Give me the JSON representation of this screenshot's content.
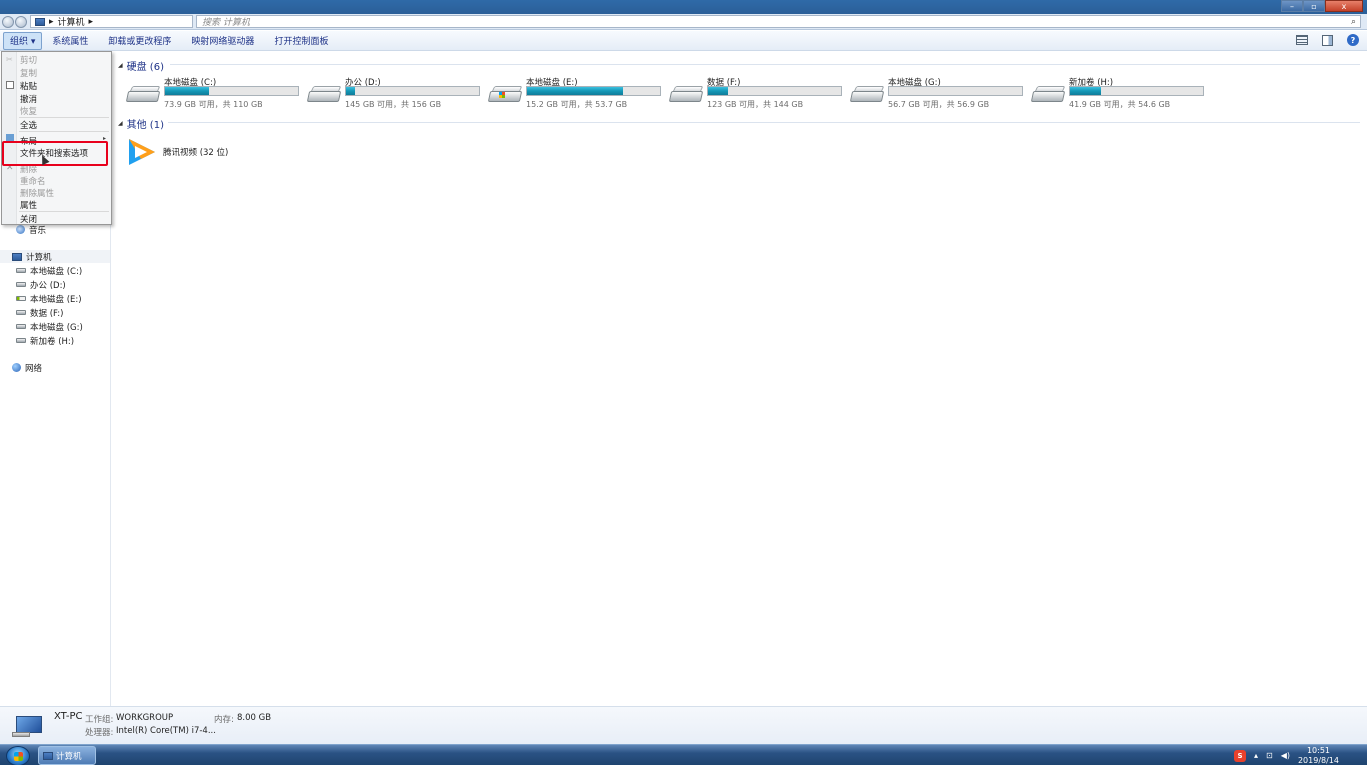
{
  "address": {
    "crumb_label": "计算机",
    "arrow": "▸"
  },
  "search": {
    "placeholder": "搜索 计算机"
  },
  "toolbar": {
    "organize_label": "组织 ▾",
    "items": [
      "系统属性",
      "卸载或更改程序",
      "映射网络驱动器",
      "打开控制面板"
    ]
  },
  "menu": {
    "items": [
      {
        "label": "剪切",
        "disabled": true
      },
      {
        "label": "复制",
        "disabled": true
      },
      {
        "label": "粘贴",
        "disabled": false
      },
      {
        "label": "撤消",
        "disabled": false
      },
      {
        "label": "恢复",
        "disabled": true
      },
      {
        "label": "全选",
        "disabled": false
      },
      {
        "label": "布局",
        "disabled": false
      },
      {
        "label": "文件夹和搜索选项",
        "disabled": false
      },
      {
        "label": "删除",
        "disabled": true
      },
      {
        "label": "重命名",
        "disabled": true
      },
      {
        "label": "删除属性",
        "disabled": true
      },
      {
        "label": "属性",
        "disabled": false
      },
      {
        "label": "关闭",
        "disabled": false
      }
    ]
  },
  "nav": {
    "music": "音乐",
    "computer": "计算机",
    "drives": [
      "本地磁盘 (C:)",
      "办公 (D:)",
      "本地磁盘 (E:)",
      "数据 (F:)",
      "本地磁盘 (G:)",
      "新加卷 (H:)"
    ],
    "network": "网络"
  },
  "content": {
    "hdd_header": "硬盘 (6)",
    "other_header": "其他 (1)",
    "drives": [
      {
        "name": "本地磁盘 (C:)",
        "info": "73.9 GB 可用，共 110 GB",
        "used_pct": 33
      },
      {
        "name": "办公 (D:)",
        "info": "145 GB 可用，共 156 GB",
        "used_pct": 7
      },
      {
        "name": "本地磁盘 (E:)",
        "info": "15.2 GB 可用，共 53.7 GB",
        "used_pct": 72
      },
      {
        "name": "数据 (F:)",
        "info": "123 GB 可用，共 144 GB",
        "used_pct": 15
      },
      {
        "name": "本地磁盘 (G:)",
        "info": "56.7 GB 可用，共 56.9 GB",
        "used_pct": 0
      },
      {
        "name": "新加卷 (H:)",
        "info": "41.9 GB 可用，共 54.6 GB",
        "used_pct": 23
      }
    ],
    "app": {
      "name": "腾讯视频 (32 位)"
    }
  },
  "details": {
    "pc_name": "XT-PC",
    "workgroup_label": "工作组:",
    "workgroup_value": "WORKGROUP",
    "memory_label": "内存:",
    "memory_value": "8.00 GB",
    "cpu_label": "处理器:",
    "cpu_value": "Intel(R) Core(TM) i7-4..."
  },
  "taskbar": {
    "task_label": "计算机",
    "sogou": "S",
    "time": "10:51",
    "date": "2019/8/14"
  },
  "window": {
    "min": "–",
    "max": "▫",
    "close": "x"
  }
}
